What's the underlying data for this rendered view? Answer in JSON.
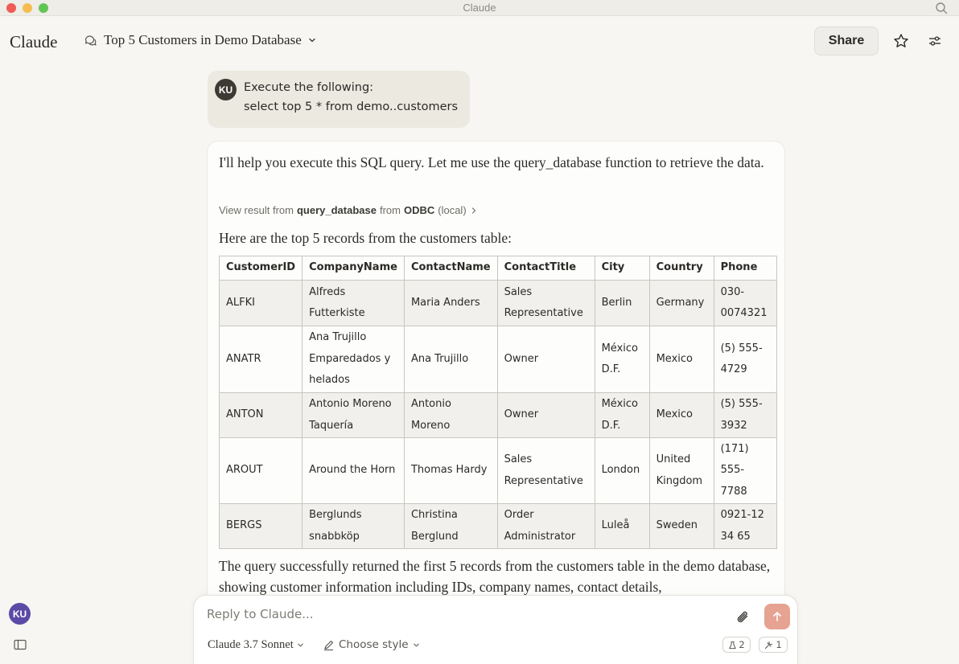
{
  "window": {
    "title": "Claude"
  },
  "header": {
    "logo": "Claude",
    "conversation_title": "Top 5 Customers in Demo Database",
    "share_label": "Share"
  },
  "user_message": {
    "avatar": "KU",
    "lines": [
      "Execute the following:",
      "select top 5 * from demo..customers"
    ]
  },
  "assistant": {
    "intro": "I'll help you execute this SQL query. Let me use the query_database function to retrieve the data.",
    "tool_link": {
      "prefix": "View result from",
      "tool": "query_database",
      "mid": "from",
      "server": "ODBC",
      "suffix": "(local)"
    },
    "lead": "Here are the top 5 records from the customers table:",
    "table": {
      "headers": [
        "CustomerID",
        "CompanyName",
        "ContactName",
        "ContactTitle",
        "City",
        "Country",
        "Phone"
      ],
      "rows": [
        [
          "ALFKI",
          "Alfreds Futterkiste",
          "Maria Anders",
          "Sales Representative",
          "Berlin",
          "Germany",
          "030-0074321"
        ],
        [
          "ANATR",
          "Ana Trujillo Emparedados y helados",
          "Ana Trujillo",
          "Owner",
          "México D.F.",
          "Mexico",
          "(5) 555-4729"
        ],
        [
          "ANTON",
          "Antonio Moreno Taquería",
          "Antonio Moreno",
          "Owner",
          "México D.F.",
          "Mexico",
          "(5) 555-3932"
        ],
        [
          "AROUT",
          "Around the Horn",
          "Thomas Hardy",
          "Sales Representative",
          "London",
          "United Kingdom",
          "(171) 555-7788"
        ],
        [
          "BERGS",
          "Berglunds snabbköp",
          "Christina Berglund",
          "Order Administrator",
          "Luleå",
          "Sweden",
          "0921-12 34 65"
        ]
      ]
    },
    "summary": "The query successfully returned the first 5 records from the customers table in the demo database, showing customer information including IDs, company names, contact details,"
  },
  "composer": {
    "placeholder": "Reply to Claude...",
    "model": "Claude 3.7 Sonnet",
    "style": "Choose style",
    "badge_a": "2",
    "badge_b": "1"
  },
  "sidebar": {
    "avatar": "KU"
  }
}
